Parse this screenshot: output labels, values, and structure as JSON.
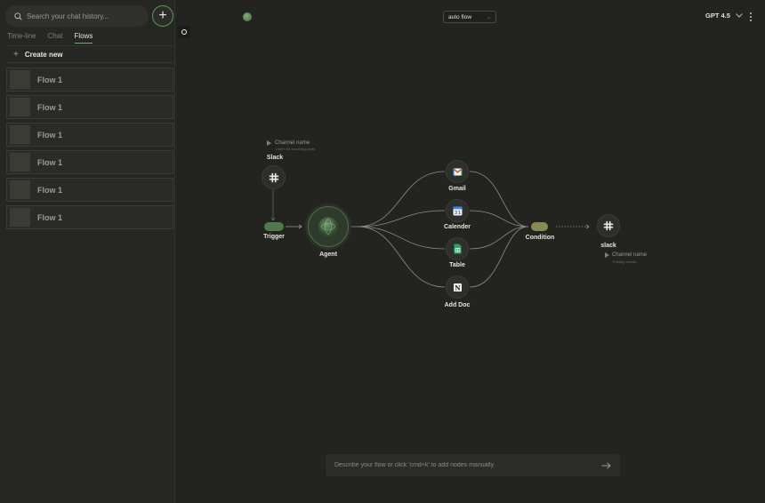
{
  "sidebar": {
    "search_placeholder": "Search your chat history...",
    "new_button": "+",
    "tabs": [
      {
        "label": "Time-line",
        "active": false
      },
      {
        "label": "Chat",
        "active": false
      },
      {
        "label": "Flows",
        "active": true
      }
    ],
    "create_new": {
      "icon": "+",
      "label": "Create new"
    },
    "flows": [
      {
        "label": "Flow 1"
      },
      {
        "label": "Flow 1"
      },
      {
        "label": "Flow 1"
      },
      {
        "label": "Flow 1"
      },
      {
        "label": "Flow 1"
      },
      {
        "label": "Flow 1"
      }
    ]
  },
  "topbar": {
    "mode": "auto flow",
    "model": "GPT 4.5"
  },
  "flow": {
    "slack_in": {
      "label": "Slack",
      "channel": "Channel name",
      "caption": "Listen for incoming posts"
    },
    "trigger": {
      "label": "Trigger"
    },
    "agent": {
      "label": "Agent"
    },
    "tools": [
      {
        "label": "Gmail",
        "icon": "gmail-icon"
      },
      {
        "label": "Calender",
        "icon": "calendar-icon"
      },
      {
        "label": "Table",
        "icon": "sheets-icon"
      },
      {
        "label": "Add Doc",
        "icon": "notion-icon"
      }
    ],
    "condition": {
      "label": "Condition"
    },
    "slack_out": {
      "label": "slack",
      "channel": "Channel name",
      "caption": "Posting events"
    }
  },
  "prompt": {
    "placeholder": "Describe your flow or click 'cmd+k' to add nodes manually",
    "send_icon": "arrow-right-icon"
  },
  "colors": {
    "background": "#23241f",
    "accent_green": "#5a9b59",
    "condition": "#8b8a4e"
  }
}
